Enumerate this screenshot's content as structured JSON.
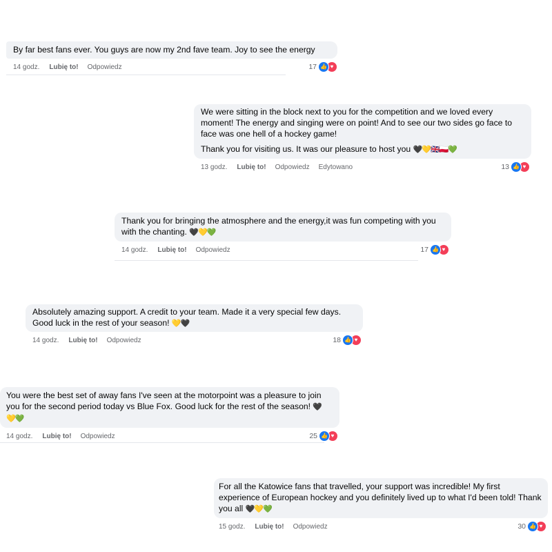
{
  "labels": {
    "like": "Lubię to!",
    "reply": "Odpowiedz",
    "edited": "Edytowano"
  },
  "colors": {
    "bubble": "#f0f2f5",
    "like_reaction": "#1877f2",
    "love_reaction": "#f33e58",
    "meta_text": "#65676b"
  },
  "icons": [
    "like-reaction-icon",
    "love-reaction-icon"
  ],
  "comments": [
    {
      "paragraphs": [
        "By far best fans ever. You guys are now my 2nd fave team. Joy to see the energy"
      ],
      "time": "14 godz.",
      "reactions": "17"
    },
    {
      "paragraphs": [
        "We were sitting in the block next to you for the competition and we loved every moment! The energy and singing were on point! And to see our two sides go face to face was one hell of a hockey game!",
        "Thank you for visiting us. It was our pleasure to host you"
      ],
      "emoji": "🖤💛🇬🇧🇵🇱💚",
      "time": "13 godz.",
      "edited": true,
      "reactions": "13"
    },
    {
      "paragraphs": [
        "Thank you for bringing the atmosphere and the energy,it was fun competing with you with the chanting."
      ],
      "emoji": "🖤💛💚",
      "time": "14 godz.",
      "reactions": "17"
    },
    {
      "paragraphs": [
        "Absolutely amazing support. A credit to your team. Made it a very special few days. Good luck in the rest of your season!"
      ],
      "emoji": "💛🖤",
      "time": "14 godz.",
      "reactions": "18"
    },
    {
      "paragraphs": [
        "You were the best set of away fans I've seen at the motorpoint was a pleasure to join you for the second period today vs Blue Fox. Good luck for the rest of the season!"
      ],
      "emoji": "🖤💛💚",
      "time": "14 godz.",
      "reactions": "25"
    },
    {
      "paragraphs": [
        "For all the Katowice fans that travelled, your support was incredible! My first experience of European hockey and you definitely lived up to what I'd been told! Thank you all"
      ],
      "emoji": "🖤💛💚",
      "time": "15 godz.",
      "reactions": "30"
    }
  ]
}
